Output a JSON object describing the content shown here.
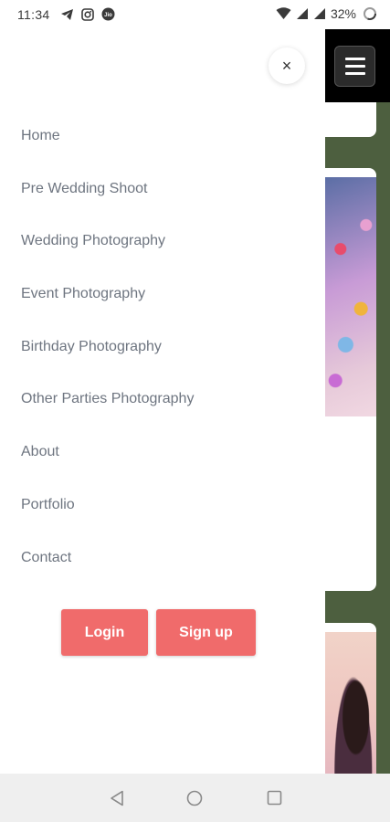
{
  "status_bar": {
    "time": "11:34",
    "left_icons": [
      "telegram-icon",
      "instagram-icon",
      "jio-icon"
    ],
    "right_icons": [
      "wifi-icon",
      "signal-icon",
      "signal-icon"
    ],
    "battery": "32%"
  },
  "drawer": {
    "close_label": "×",
    "nav_items": [
      {
        "label": "Home"
      },
      {
        "label": "Pre Wedding Shoot"
      },
      {
        "label": "Wedding Photography"
      },
      {
        "label": "Event Photography"
      },
      {
        "label": "Birthday Photography"
      },
      {
        "label": "Other Parties Photography"
      },
      {
        "label": "About"
      },
      {
        "label": "Portfolio"
      },
      {
        "label": "Contact"
      }
    ],
    "login_label": "Login",
    "signup_label": "Sign up"
  },
  "colors": {
    "accent": "#f06b6b",
    "nav_text": "#6e7580",
    "backdrop": "#4d5f3f"
  },
  "system_nav": [
    "back-icon",
    "home-icon",
    "recents-icon"
  ]
}
